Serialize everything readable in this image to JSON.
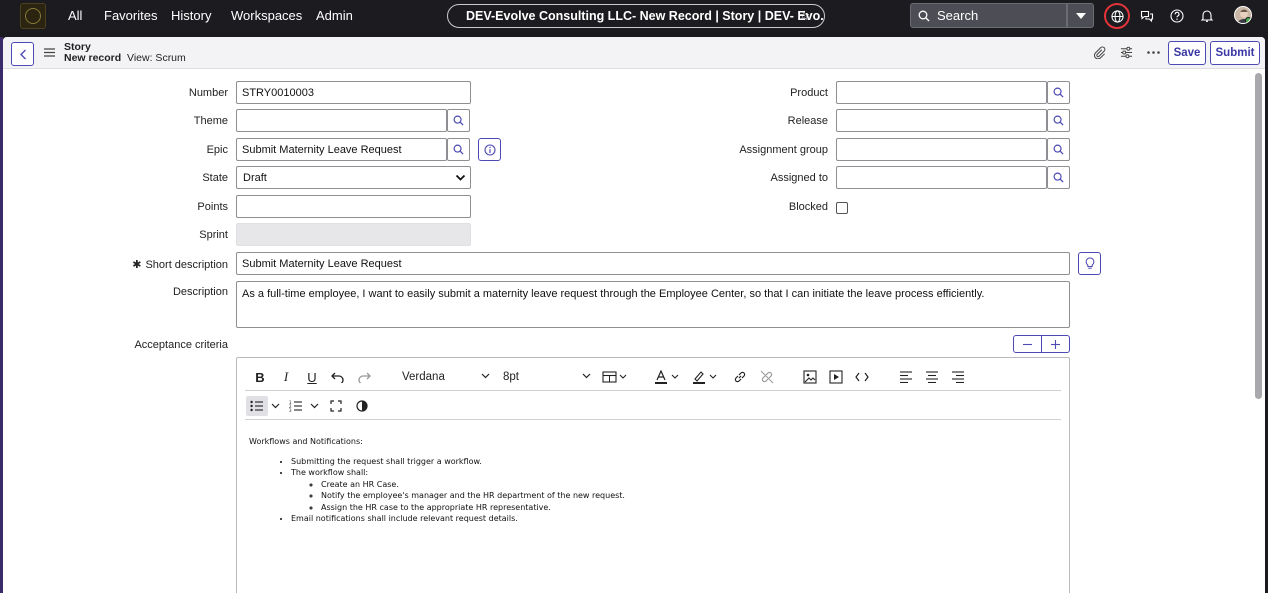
{
  "topnav": {
    "links": [
      "All",
      "Favorites",
      "History",
      "Workspaces",
      "Admin"
    ],
    "title": "DEV-Evolve Consulting LLC- New Record | Story | DEV- Evo...",
    "search_label": "Search"
  },
  "header": {
    "record_type": "Story",
    "record_status": "New record",
    "view_label": "View: Scrum",
    "save_label": "Save",
    "submit_label": "Submit"
  },
  "form": {
    "number_label": "Number",
    "number_value": "STRY0010003",
    "theme_label": "Theme",
    "theme_value": "",
    "epic_label": "Epic",
    "epic_value": "Submit Maternity Leave Request",
    "state_label": "State",
    "state_value": "Draft",
    "points_label": "Points",
    "points_value": "",
    "sprint_label": "Sprint",
    "product_label": "Product",
    "release_label": "Release",
    "assignment_group_label": "Assignment group",
    "assigned_to_label": "Assigned to",
    "blocked_label": "Blocked",
    "required_marker": "✱",
    "short_description_label": "Short description",
    "short_description_value": "Submit Maternity Leave Request",
    "description_label": "Description",
    "description_value": "As a full-time employee, I want to easily submit a maternity leave request through the Employee Center, so that I can initiate the leave process efficiently.",
    "acceptance_label": "Acceptance criteria"
  },
  "editor": {
    "font_family": "Verdana",
    "font_size": "8pt",
    "heading": "Workflows and Notifications:",
    "items": {
      "first": "Submitting the request shall trigger a workflow.",
      "second": "The workflow shall:",
      "sub": [
        "Create an HR Case.",
        "Notify the employee's manager and the HR department of the new request.",
        "Assign the HR case to the appropriate HR representative."
      ],
      "third": "Email notifications shall include relevant request details."
    }
  },
  "colors": {
    "nav_bg": "#1c1c20",
    "accent": "#4d4ab3",
    "alert_ring": "#e3343a"
  }
}
